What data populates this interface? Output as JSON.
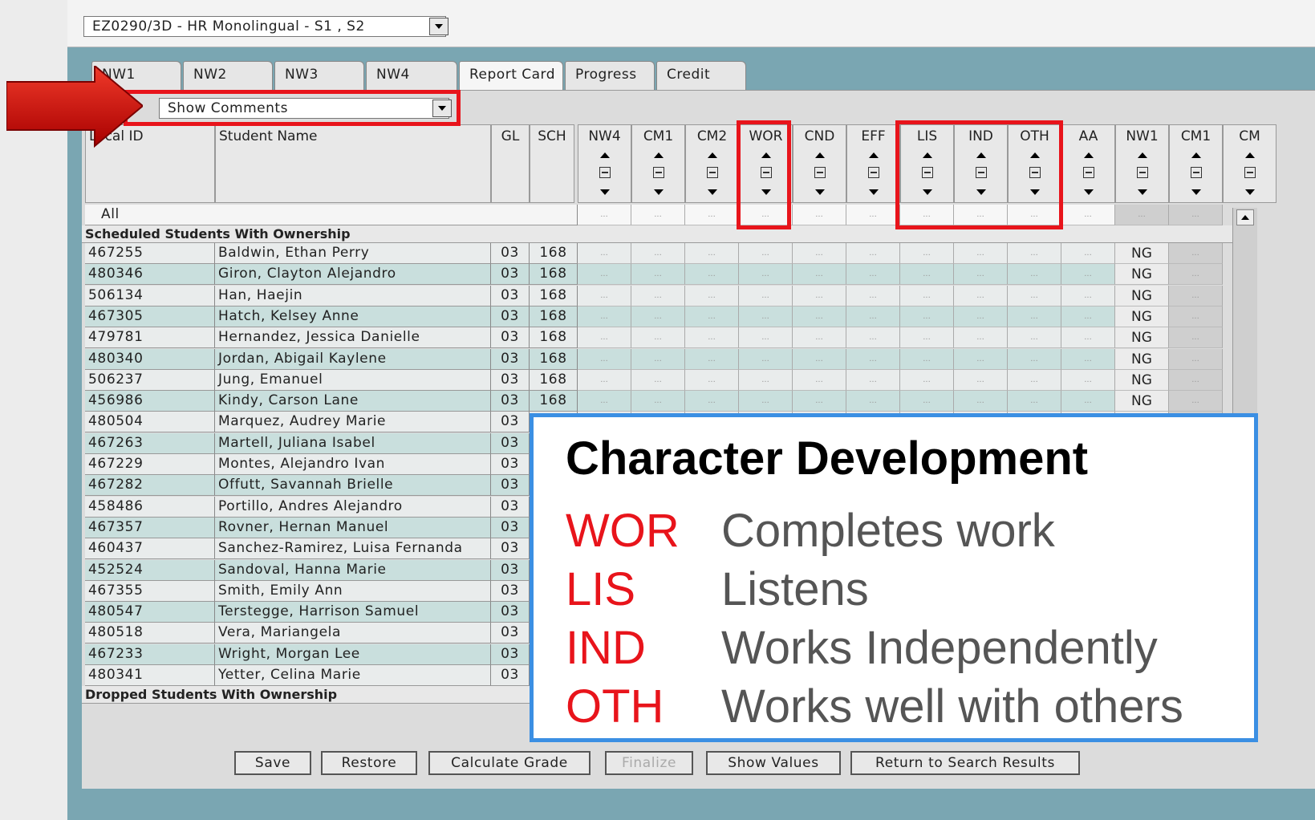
{
  "window": {
    "class_selector": "EZ0290/3D - HR Monolingual - S1 , S2"
  },
  "tabs": [
    {
      "label": "NW1",
      "active": false
    },
    {
      "label": "NW2",
      "active": false
    },
    {
      "label": "NW3",
      "active": false
    },
    {
      "label": "NW4",
      "active": false
    },
    {
      "label": "Report Card",
      "active": true
    },
    {
      "label": "Progress",
      "active": false
    },
    {
      "label": "Credit",
      "active": false
    }
  ],
  "view_selector": "Show Comments",
  "columns": {
    "local_id": "Local ID",
    "student_name": "Student Name",
    "gl": "GL",
    "sch": "SCH",
    "grades": [
      "NW4",
      "CM1",
      "CM2",
      "WOR",
      "CND",
      "EFF",
      "LIS",
      "IND",
      "OTH",
      "AA",
      "NW1",
      "CM1",
      "CM"
    ]
  },
  "all_row_label": "All",
  "sections": {
    "scheduled": "Scheduled Students With Ownership",
    "dropped": "Dropped Students With Ownership"
  },
  "students": [
    {
      "id": "467255",
      "name": "Baldwin, Ethan Perry",
      "gl": "03",
      "sch": "168",
      "nw1": "NG"
    },
    {
      "id": "480346",
      "name": "Giron, Clayton Alejandro",
      "gl": "03",
      "sch": "168",
      "nw1": "NG"
    },
    {
      "id": "506134",
      "name": "Han, Haejin",
      "gl": "03",
      "sch": "168",
      "nw1": "NG"
    },
    {
      "id": "467305",
      "name": "Hatch, Kelsey Anne",
      "gl": "03",
      "sch": "168",
      "nw1": "NG"
    },
    {
      "id": "479781",
      "name": "Hernandez, Jessica Danielle",
      "gl": "03",
      "sch": "168",
      "nw1": "NG"
    },
    {
      "id": "480340",
      "name": "Jordan, Abigail Kaylene",
      "gl": "03",
      "sch": "168",
      "nw1": "NG"
    },
    {
      "id": "506237",
      "name": "Jung, Emanuel",
      "gl": "03",
      "sch": "168",
      "nw1": "NG"
    },
    {
      "id": "456986",
      "name": "Kindy, Carson Lane",
      "gl": "03",
      "sch": "168",
      "nw1": "NG"
    },
    {
      "id": "480504",
      "name": "Marquez, Audrey Marie",
      "gl": "03",
      "sch": "",
      "nw1": ""
    },
    {
      "id": "467263",
      "name": "Martell, Juliana Isabel",
      "gl": "03",
      "sch": "",
      "nw1": ""
    },
    {
      "id": "467229",
      "name": "Montes, Alejandro Ivan",
      "gl": "03",
      "sch": "",
      "nw1": ""
    },
    {
      "id": "467282",
      "name": "Offutt, Savannah Brielle",
      "gl": "03",
      "sch": "",
      "nw1": ""
    },
    {
      "id": "458486",
      "name": "Portillo, Andres Alejandro",
      "gl": "03",
      "sch": "",
      "nw1": ""
    },
    {
      "id": "467357",
      "name": "Rovner, Hernan Manuel",
      "gl": "03",
      "sch": "",
      "nw1": ""
    },
    {
      "id": "460437",
      "name": "Sanchez-Ramirez, Luisa Fernanda",
      "gl": "03",
      "sch": "",
      "nw1": ""
    },
    {
      "id": "452524",
      "name": "Sandoval, Hanna Marie",
      "gl": "03",
      "sch": "",
      "nw1": ""
    },
    {
      "id": "467355",
      "name": "Smith, Emily Ann",
      "gl": "03",
      "sch": "",
      "nw1": ""
    },
    {
      "id": "480547",
      "name": "Terstegge, Harrison Samuel",
      "gl": "03",
      "sch": "",
      "nw1": ""
    },
    {
      "id": "480518",
      "name": "Vera, Mariangela",
      "gl": "03",
      "sch": "",
      "nw1": ""
    },
    {
      "id": "467233",
      "name": "Wright, Morgan Lee",
      "gl": "03",
      "sch": "",
      "nw1": ""
    },
    {
      "id": "480341",
      "name": "Yetter, Celina Marie",
      "gl": "03",
      "sch": "",
      "nw1": ""
    }
  ],
  "buttons": [
    {
      "label": "Save",
      "enabled": true
    },
    {
      "label": "Restore",
      "enabled": true
    },
    {
      "label": "Calculate Grade",
      "enabled": true
    },
    {
      "label": "Finalize",
      "enabled": false
    },
    {
      "label": "Show Values",
      "enabled": true
    },
    {
      "label": "Return to Search Results",
      "enabled": true
    }
  ],
  "callout": {
    "title": "Character Development",
    "items": [
      {
        "code": "WOR",
        "desc": "Completes work"
      },
      {
        "code": "LIS",
        "desc": "Listens"
      },
      {
        "code": "IND",
        "desc": "Works Independently"
      },
      {
        "code": "OTH",
        "desc": "Works well with others"
      }
    ]
  },
  "colors": {
    "accent_red": "#e8141b",
    "callout_border": "#3b8fe3",
    "window_bg": "#7aa6b2",
    "row_alt": "#c9dfdd"
  }
}
